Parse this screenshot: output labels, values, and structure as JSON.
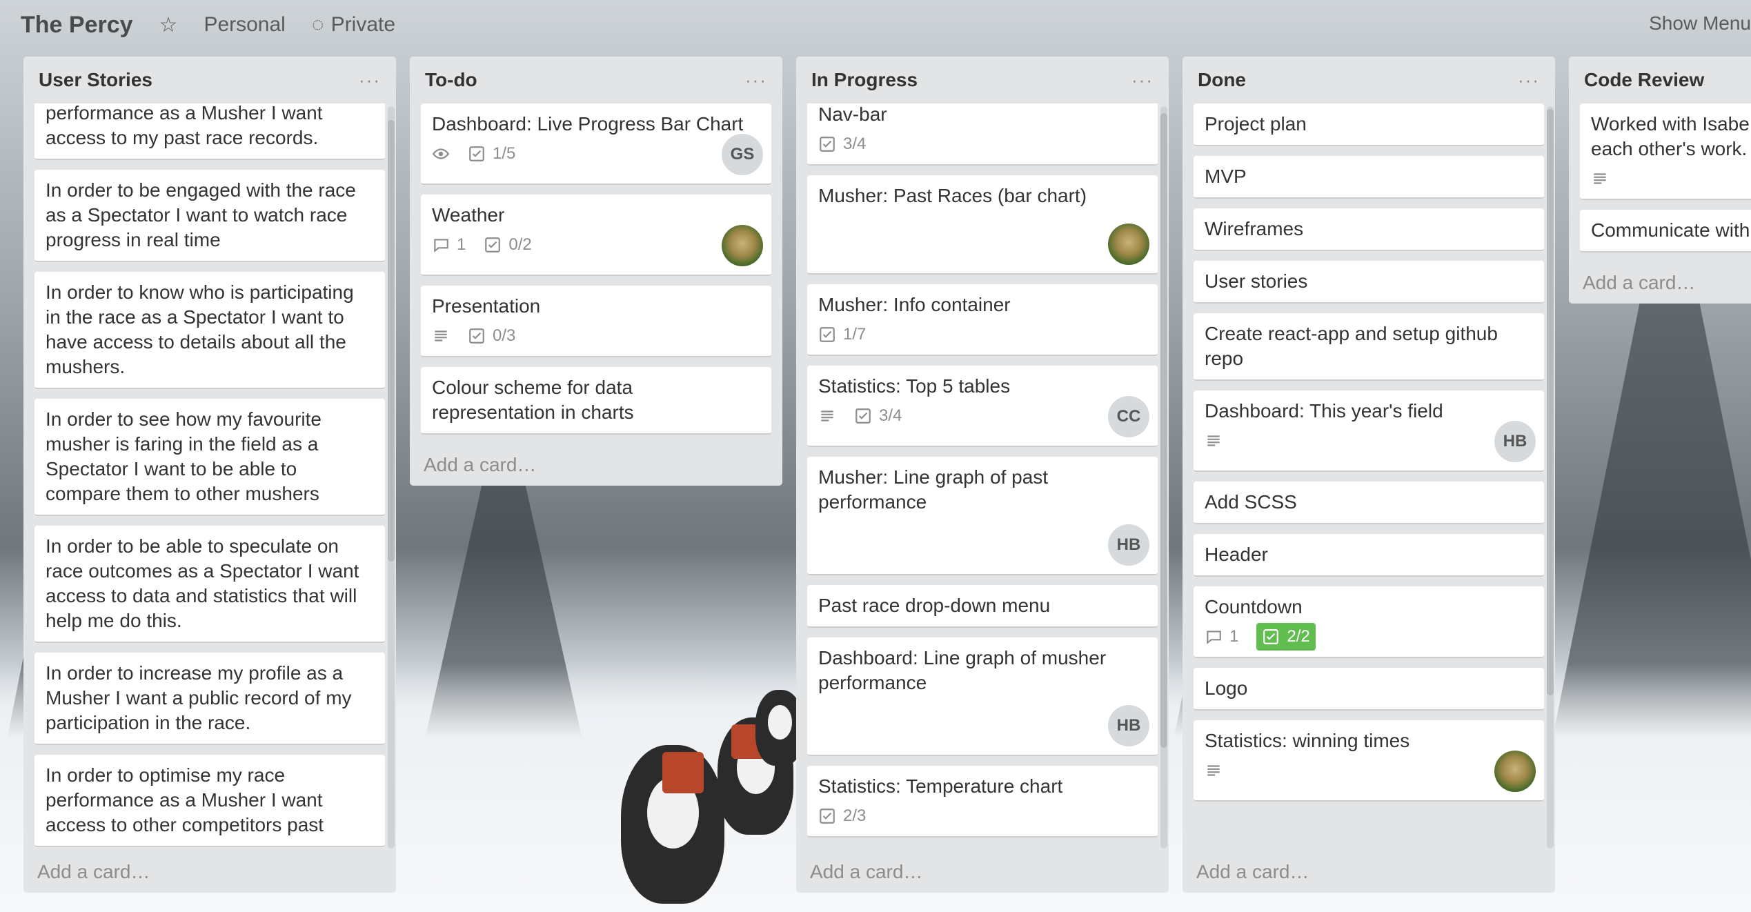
{
  "board": {
    "title": "The Percy",
    "visibility_team": "Personal",
    "visibility": "Private",
    "show_menu": "Show Menu"
  },
  "lists": [
    {
      "title": "User Stories",
      "menu": "···",
      "add_card": "Add a card…",
      "cards": [
        {
          "text": "performance as a Musher I want access to my past race records."
        },
        {
          "text": "In order to be engaged with the race as a Spectator I want to watch race progress in real time"
        },
        {
          "text": "In order to know who is participating in the race as a Spectator I want to have access to details about all the mushers."
        },
        {
          "text": "In order to see how my favourite musher is faring in the field as a Spectator I want to be able to compare them to other mushers"
        },
        {
          "text": "In order to be able to speculate on race outcomes as a Spectator I want access to data and statistics that will help me do this."
        },
        {
          "text": "In order to increase my profile as a Musher I want a public record of my participation in the race."
        },
        {
          "text": "In order to optimise my race performance as a Musher I want access to other competitors past"
        }
      ]
    },
    {
      "title": "To-do",
      "menu": "···",
      "add_card": "Add a card…",
      "cards": [
        {
          "text": "Dashboard: Live Progress Bar Chart",
          "watch": true,
          "checklist": "1/5",
          "avatar": "GS"
        },
        {
          "text": "Weather",
          "comments": "1",
          "checklist": "0/2",
          "avatar_photo": true
        },
        {
          "text": "Presentation",
          "description": true,
          "checklist": "0/3"
        },
        {
          "text": "Colour scheme for data representation in charts"
        }
      ]
    },
    {
      "title": "In Progress",
      "menu": "···",
      "add_card": "Add a card…",
      "cards": [
        {
          "text": "Nav-bar",
          "checklist": "3/4"
        },
        {
          "text": "Musher: Past Races (bar chart)",
          "avatar_photo": true
        },
        {
          "text": "Musher: Info container",
          "checklist": "1/7"
        },
        {
          "text": "Statistics: Top 5 tables",
          "description": true,
          "checklist": "3/4",
          "avatar": "CC"
        },
        {
          "text": "Musher: Line graph of past performance",
          "avatar": "HB"
        },
        {
          "text": "Past race drop-down menu"
        },
        {
          "text": "Dashboard: Line graph of musher performance",
          "avatar": "HB"
        },
        {
          "text": "Statistics: Temperature chart",
          "checklist": "2/3"
        }
      ]
    },
    {
      "title": "Done",
      "menu": "···",
      "add_card": "Add a card…",
      "cards": [
        {
          "text": "Project plan"
        },
        {
          "text": "MVP"
        },
        {
          "text": "Wireframes"
        },
        {
          "text": "User stories"
        },
        {
          "text": "Create react-app and setup github repo"
        },
        {
          "text": "Dashboard: This year's field",
          "description": true,
          "avatar": "HB"
        },
        {
          "text": "Add SCSS"
        },
        {
          "text": "Header"
        },
        {
          "text": "Countdown",
          "comments": "1",
          "checklist_done": "2/2"
        },
        {
          "text": "Logo"
        },
        {
          "text": "Statistics: winning times",
          "description": true,
          "avatar_photo": true
        }
      ]
    },
    {
      "title": "Code Review",
      "menu": "···",
      "add_card": "Add a card…",
      "cards": [
        {
          "text": "Worked with Isabe each other's work.",
          "description": true
        },
        {
          "text": "Communicate with"
        }
      ]
    }
  ],
  "colors": {
    "list_bg": "#e2e4e6",
    "card_bg": "#ffffff",
    "done_badge": "#61bd4f"
  }
}
